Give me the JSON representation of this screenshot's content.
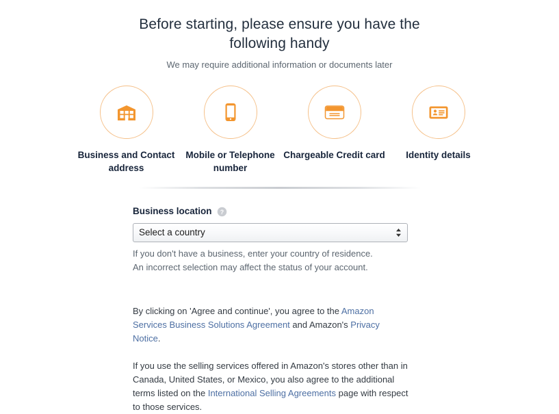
{
  "header": {
    "title": "Before starting, please ensure you have the following handy",
    "subtitle": "We may require additional information or documents later"
  },
  "requirements": [
    {
      "icon": "building-icon",
      "label": "Business and Contact address"
    },
    {
      "icon": "mobile-phone-icon",
      "label": "Mobile or Telephone number"
    },
    {
      "icon": "credit-card-icon",
      "label": "Chargeable Credit card"
    },
    {
      "icon": "id-card-icon",
      "label": "Identity details"
    }
  ],
  "form": {
    "label": "Business location",
    "help_icon": "help-circle-icon",
    "select_value": "Select a country",
    "helper_line_1": "If you don't have a business, enter your country of residence.",
    "helper_line_2": "An incorrect selection may affect the status of your account."
  },
  "legal": {
    "p1_a": "By clicking on 'Agree and continue', you agree to the ",
    "p1_link1": "Amazon Services Business Solutions Agreement",
    "p1_b": " and Amazon's ",
    "p1_link2": "Privacy Notice",
    "p1_c": ".",
    "p2_a": "If you use the selling services offered in Amazon's stores other than in Canada, United States, or Mexico, you also agree to the additional terms listed on the ",
    "p2_link1": "International Selling Agreements",
    "p2_b": " page with respect to those services."
  },
  "colors": {
    "accent_orange": "#f3962f",
    "ring_orange": "#f5c089",
    "link_blue": "#4d6fa3",
    "heading_navy": "#232f3e",
    "muted_gray": "#5c6670"
  }
}
